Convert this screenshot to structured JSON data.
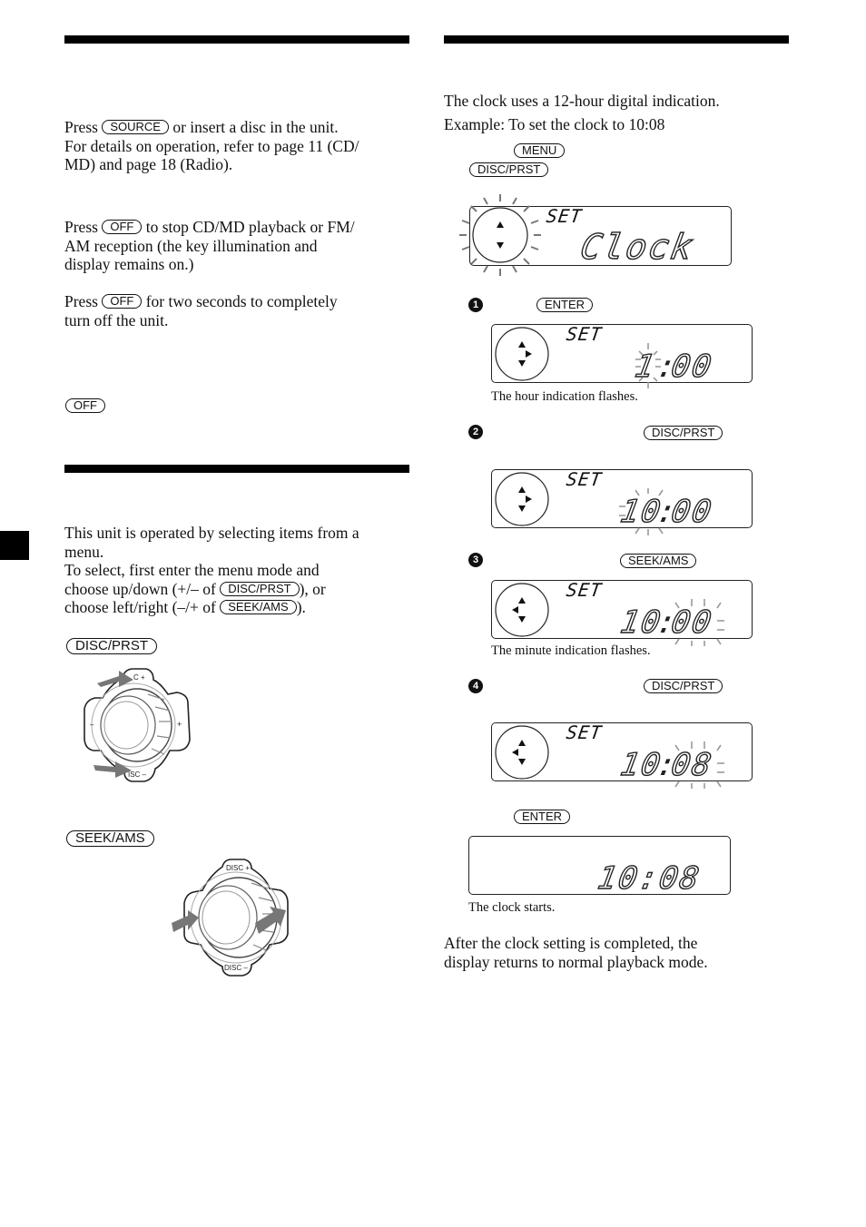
{
  "left_column": {
    "source_section": {
      "paragraph_pre": "Press",
      "source_key": "SOURCE",
      "paragraph_post_line1": "or insert a disc in the unit.",
      "paragraph_line2": "For details on operation, refer to page 11 (CD/",
      "paragraph_line3": "MD) and page 18 (Radio)."
    },
    "off_section": {
      "p1_pre": "Press",
      "p1_key": "OFF",
      "p1_post": "to stop CD/MD playback or FM/",
      "p1_line2": "AM reception (the key illumination and",
      "p1_line3": "display remains on.)",
      "p2_pre": "Press",
      "p2_key": "OFF",
      "p2_post": "for two seconds to completely",
      "p2_line2": "turn off the unit.",
      "standalone_key": "OFF"
    },
    "menu_section": {
      "line1": "This unit is operated by selecting items from a",
      "line2": "menu.",
      "line3": "To select, first enter the menu mode and",
      "line4_pre": "choose up/down (+/– of",
      "line4_key": "DISC/PRST",
      "line4_post": "), or",
      "line5_pre": "choose left/right (–/+ of",
      "line5_key": "SEEK/AMS",
      "line5_post": ").",
      "disc_key": "DISC/PRST",
      "seek_key": "SEEK/AMS",
      "knob_labels": {
        "disc_plus": "DISC +",
        "disc_minus": "DISC –",
        "minus": "–",
        "plus": "+"
      }
    }
  },
  "right_column": {
    "intro_line1": "The clock uses a 12-hour digital indication.",
    "intro_line2": "Example: To set the clock to 10:08",
    "menu_key": "MENU",
    "disc_key": "DISC/PRST",
    "display_initial": {
      "set_label": "SET",
      "main_text": "Clock"
    },
    "steps": [
      {
        "number": "1",
        "key": "ENTER",
        "display": {
          "set_label": "SET",
          "hour": "1",
          "sep": ":",
          "minute": "00",
          "flashing": "hour"
        },
        "caption": "The hour indication flashes."
      },
      {
        "number": "2",
        "key": "DISC/PRST",
        "display": {
          "set_label": "SET",
          "hour": "10",
          "sep": ":",
          "minute": "00",
          "flashing": "hour"
        },
        "caption": ""
      },
      {
        "number": "3",
        "key": "SEEK/AMS",
        "display": {
          "set_label": "SET",
          "hour": "10",
          "sep": ":",
          "minute": "00",
          "flashing": "minute"
        },
        "caption": "The minute indication flashes."
      },
      {
        "number": "4",
        "key": "DISC/PRST",
        "display": {
          "set_label": "SET",
          "hour": "10",
          "sep": ":",
          "minute": "08",
          "flashing": "minute"
        },
        "caption": ""
      }
    ],
    "final_key": "ENTER",
    "final_display": {
      "time": "10:08"
    },
    "final_caption": "The clock starts.",
    "closing_line1": "After the clock setting is completed, the",
    "closing_line2": "display returns to normal playback mode."
  }
}
